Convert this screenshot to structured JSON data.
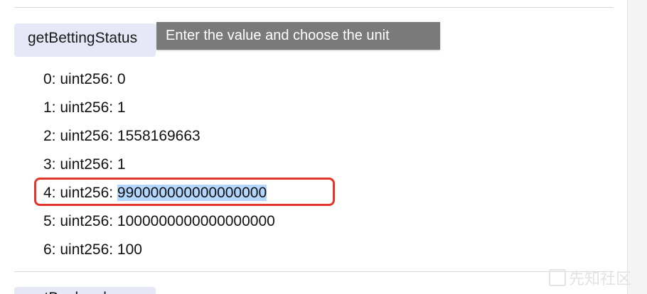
{
  "function_button": {
    "label": "getBettingStatus"
  },
  "next_function_button": {
    "label": "getBookmaker"
  },
  "tooltip": {
    "text": "Enter the value and choose the unit"
  },
  "outputs": [
    {
      "label": "0: uint256: ",
      "value": "0"
    },
    {
      "label": "1: uint256: ",
      "value": "1"
    },
    {
      "label": "2: uint256: ",
      "value": "1558169663"
    },
    {
      "label": "3: uint256: ",
      "value": "1"
    },
    {
      "label": "4: uint256: ",
      "value": "990000000000000000"
    },
    {
      "label": "5: uint256: ",
      "value": "1000000000000000000"
    },
    {
      "label": "6: uint256: ",
      "value": "100"
    }
  ],
  "highlight": {
    "row_index": 4,
    "border_color": "#e0362b",
    "selection_color": "#b3d7ff"
  },
  "watermark": {
    "text": "先知社区",
    "logo_icon": "watermark-logo-icon"
  },
  "colors": {
    "button_bg": "#e6e8f7",
    "tooltip_bg": "#7a7a7a",
    "divider": "#d9d9d9"
  }
}
